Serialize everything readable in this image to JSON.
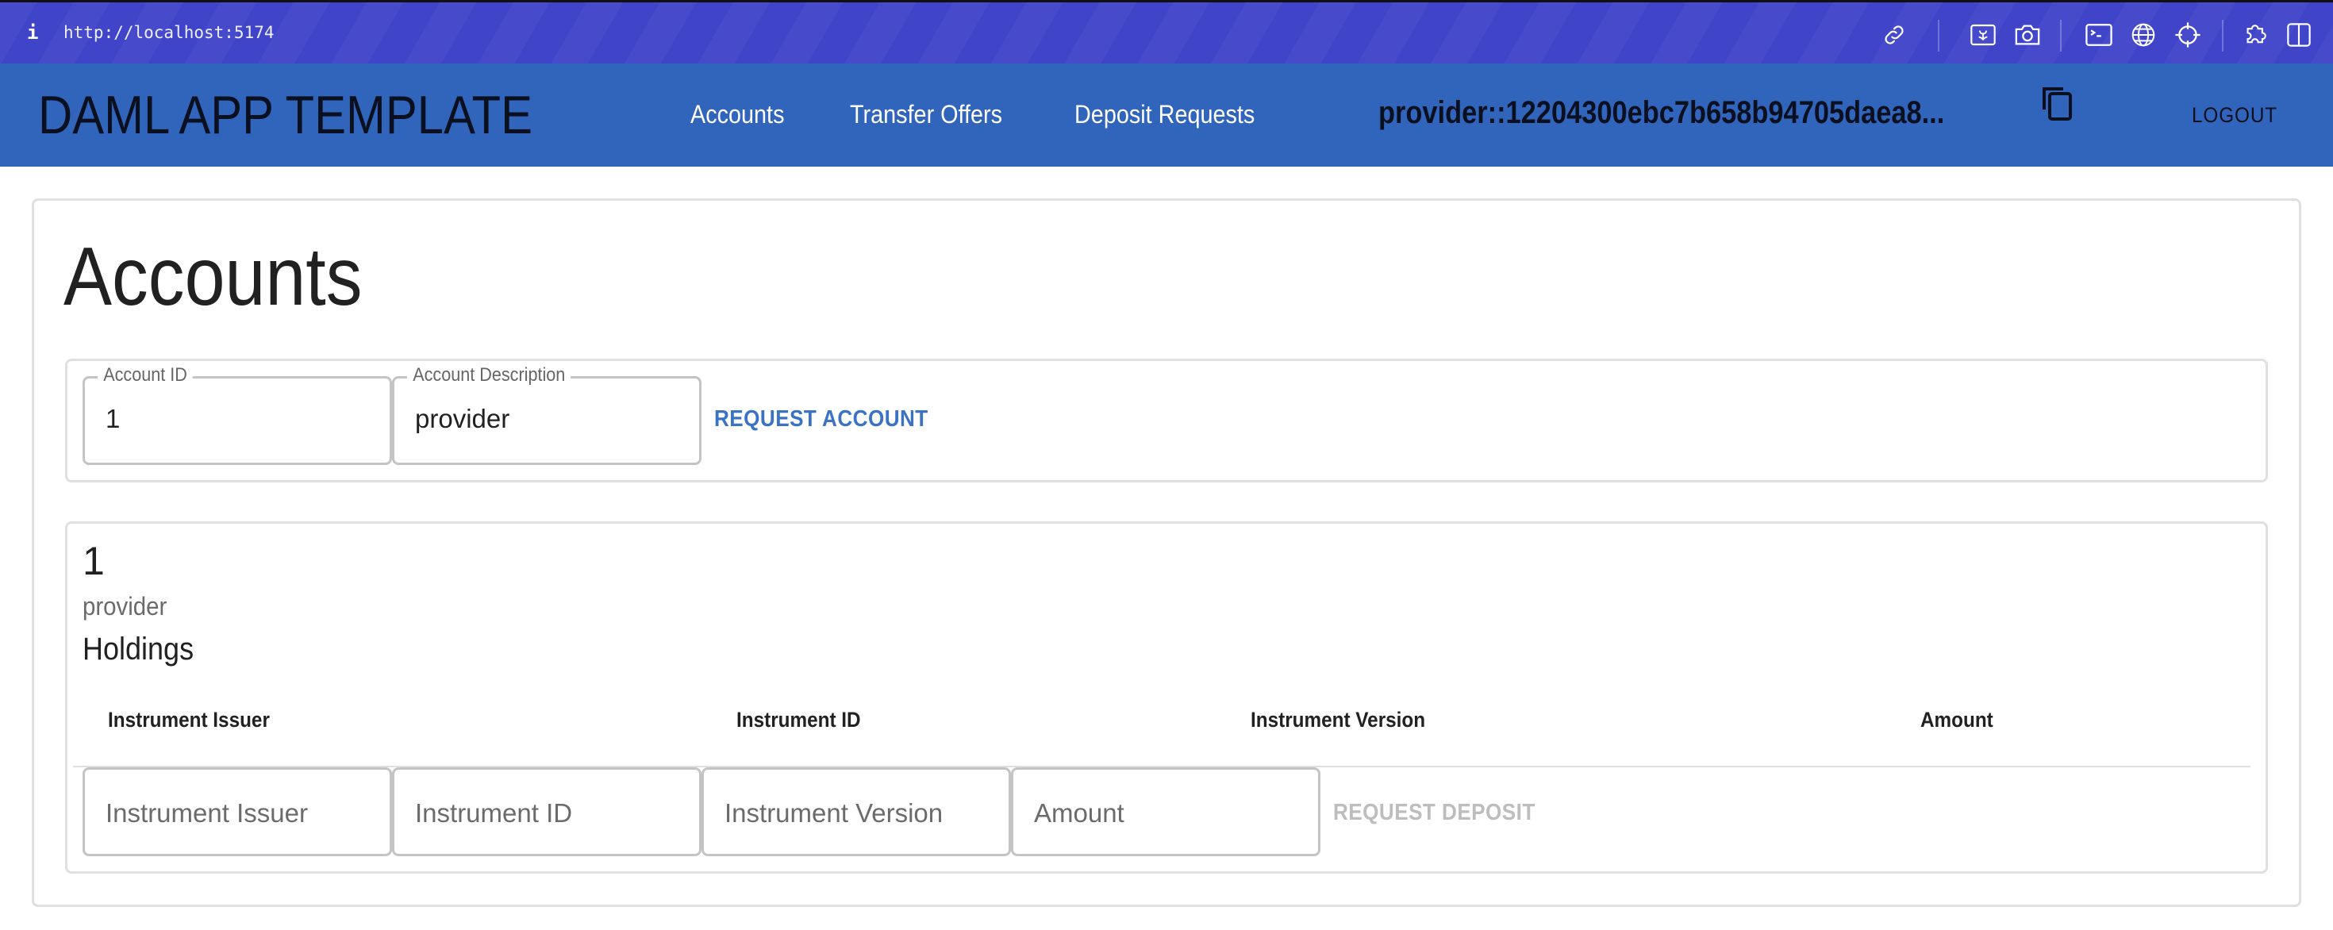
{
  "browser": {
    "info_icon": "i",
    "url": "http://localhost:5174",
    "toolbar_icons": [
      "link-icon",
      "screenshot-region-icon",
      "camera-icon",
      "terminal-icon",
      "globe-icon",
      "crosshair-icon",
      "puzzle-extension-icon",
      "split-view-icon"
    ]
  },
  "appbar": {
    "brand": "DAML APP TEMPLATE",
    "nav": [
      {
        "label": "Accounts"
      },
      {
        "label": "Transfer Offers"
      },
      {
        "label": "Deposit Requests"
      }
    ],
    "party_id": "provider::12204300ebc7b658b94705daea8...",
    "copy_icon": "copy-icon",
    "logout_label": "LOGOUT"
  },
  "page": {
    "title": "Accounts",
    "request_form": {
      "account_id": {
        "label": "Account ID",
        "value": "1"
      },
      "account_description": {
        "label": "Account Description",
        "value": "provider"
      },
      "submit_label": "REQUEST ACCOUNT"
    },
    "accounts": [
      {
        "id": "1",
        "description": "provider",
        "holdings_title": "Holdings",
        "columns": [
          "Instrument Issuer",
          "Instrument ID",
          "Instrument Version",
          "Amount"
        ],
        "rows": [],
        "deposit_form": {
          "instrument_issuer": {
            "placeholder": "Instrument Issuer",
            "value": ""
          },
          "instrument_id": {
            "placeholder": "Instrument ID",
            "value": ""
          },
          "instrument_version": {
            "placeholder": "Instrument Version",
            "value": ""
          },
          "amount": {
            "placeholder": "Amount",
            "value": ""
          },
          "submit_label": "REQUEST DEPOSIT",
          "submit_enabled": false
        }
      }
    ]
  },
  "colors": {
    "chrome_bg": "#3f44c9",
    "appbar_bg": "#3065bb",
    "primary_text_button": "#3a72c4",
    "disabled_text_button": "#bdbdbd",
    "border": "#e0e0e0"
  }
}
